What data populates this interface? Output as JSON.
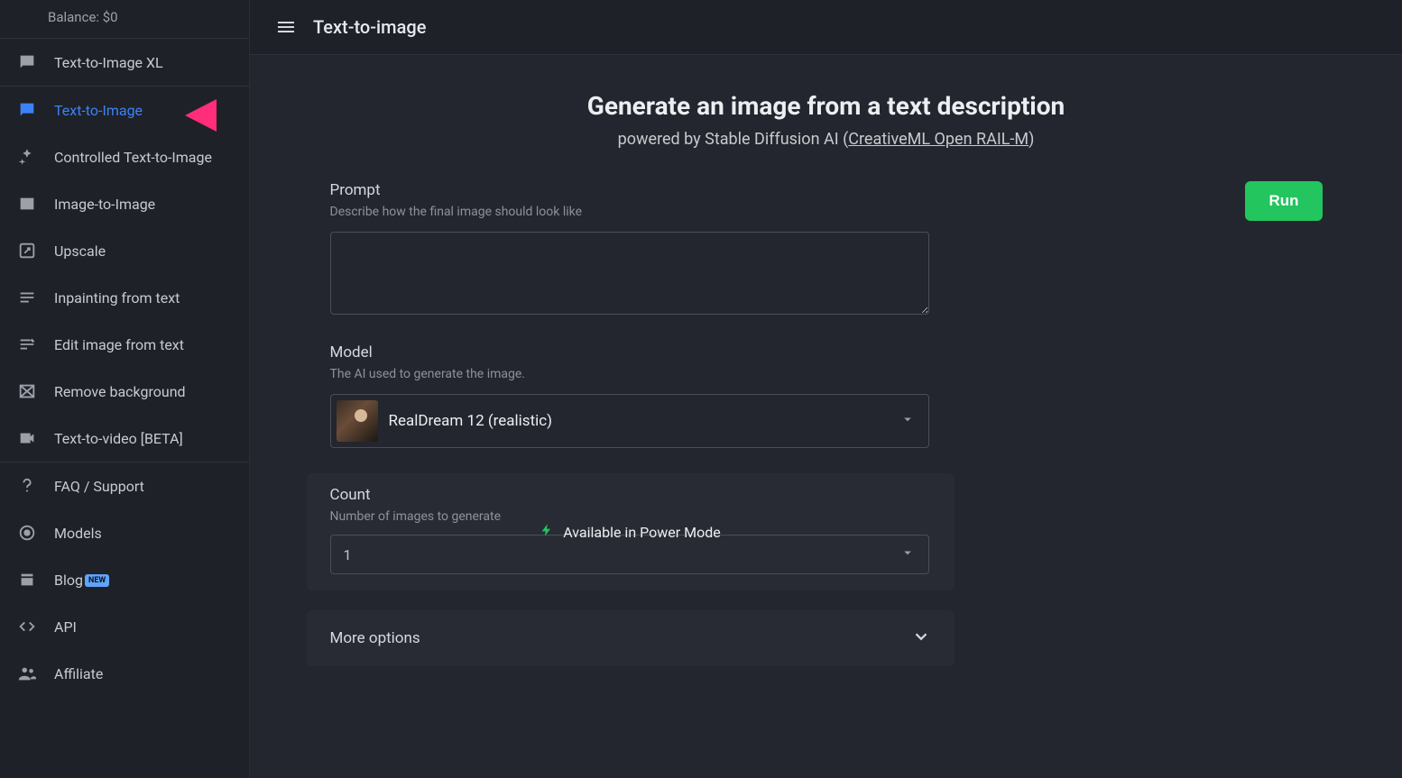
{
  "balance": "Balance: $0",
  "sidebar": {
    "items": [
      {
        "label": "Text-to-Image XL"
      },
      {
        "label": "Text-to-Image"
      },
      {
        "label": "Controlled Text-to-Image"
      },
      {
        "label": "Image-to-Image"
      },
      {
        "label": "Upscale"
      },
      {
        "label": "Inpainting from text"
      },
      {
        "label": "Edit image from text"
      },
      {
        "label": "Remove background"
      },
      {
        "label": "Text-to-video [BETA]"
      },
      {
        "label": "FAQ / Support"
      },
      {
        "label": "Models"
      },
      {
        "label": "Blog"
      },
      {
        "label": "API"
      },
      {
        "label": "Affiliate"
      }
    ],
    "new_badge": "NEW"
  },
  "header": {
    "title": "Text-to-image"
  },
  "hero": {
    "title": "Generate an image from a text description",
    "subtitle_prefix": "powered by Stable Diffusion AI ",
    "subtitle_link": "CreativeML Open RAIL-M"
  },
  "run_label": "Run",
  "prompt": {
    "label": "Prompt",
    "desc": "Describe how the final image should look like",
    "value": ""
  },
  "model": {
    "label": "Model",
    "desc": "The AI used to generate the image.",
    "selected": "RealDream 12 (realistic)"
  },
  "count": {
    "label": "Count",
    "desc": "Number of images to generate",
    "overlay": "Available in Power Mode",
    "selected": "1"
  },
  "more_options": "More options"
}
